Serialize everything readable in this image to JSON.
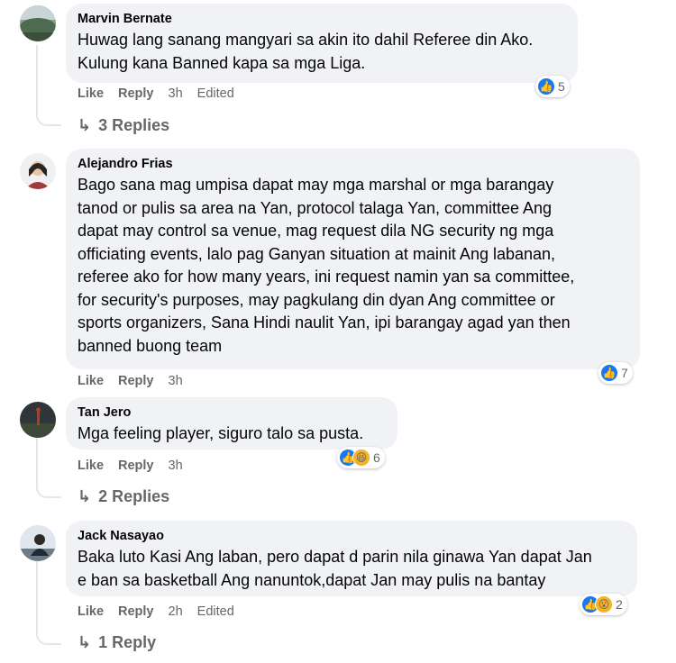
{
  "comments": [
    {
      "name": "Marvin Bernate",
      "text": "Huwag lang sanang mangyari sa akin ito dahil Referee din Ako.\nKulung kana Banned kapa sa mga Liga.",
      "like": "Like",
      "reply": "Reply",
      "time": "3h",
      "edited": "Edited",
      "reaction_count": "5",
      "reaction_icons": [
        "like-icon"
      ],
      "replies": "3 Replies"
    },
    {
      "name": "Alejandro Frias",
      "text": "Bago sana mag umpisa dapat may mga marshal or mga barangay\ntanod or pulis sa area na Yan, protocol talaga Yan, committee Ang\ndapat may control sa venue, mag request dila NG security ng mga\nofficiating events, lalo pag Ganyan situation at mainit Ang labanan,\nreferee ako for how many years, ini request namin yan sa committee,\nfor security's purposes, may pagkulang din dyan Ang committee or\nsports organizers, Sana Hindi naulit Yan, ipi barangay agad yan then\nbanned buong team",
      "like": "Like",
      "reply": "Reply",
      "time": "3h",
      "reaction_count": "7",
      "reaction_icons": [
        "like-icon"
      ]
    },
    {
      "name": "Tan Jero",
      "text": "Mga feeling player, siguro talo sa pusta.",
      "like": "Like",
      "reply": "Reply",
      "time": "3h",
      "reaction_count": "6",
      "reaction_icons": [
        "like-icon",
        "haha-icon"
      ],
      "replies": "2 Replies"
    },
    {
      "name": "Jack Nasayao",
      "text": "Baka luto Kasi Ang laban, pero dapat d parin nila ginawa Yan dapat Jan\ne ban sa basketball Ang nanuntok,dapat Jan may pulis na bantay",
      "like": "Like",
      "reply": "Reply",
      "time": "2h",
      "edited": "Edited",
      "reaction_count": "2",
      "reaction_icons": [
        "like-icon",
        "wow-icon"
      ],
      "replies": "1 Reply"
    }
  ],
  "colors": {
    "bubble": "#f0f2f5",
    "meta": "#65676b",
    "like": "#1877f2",
    "haha": "#f7b125"
  }
}
